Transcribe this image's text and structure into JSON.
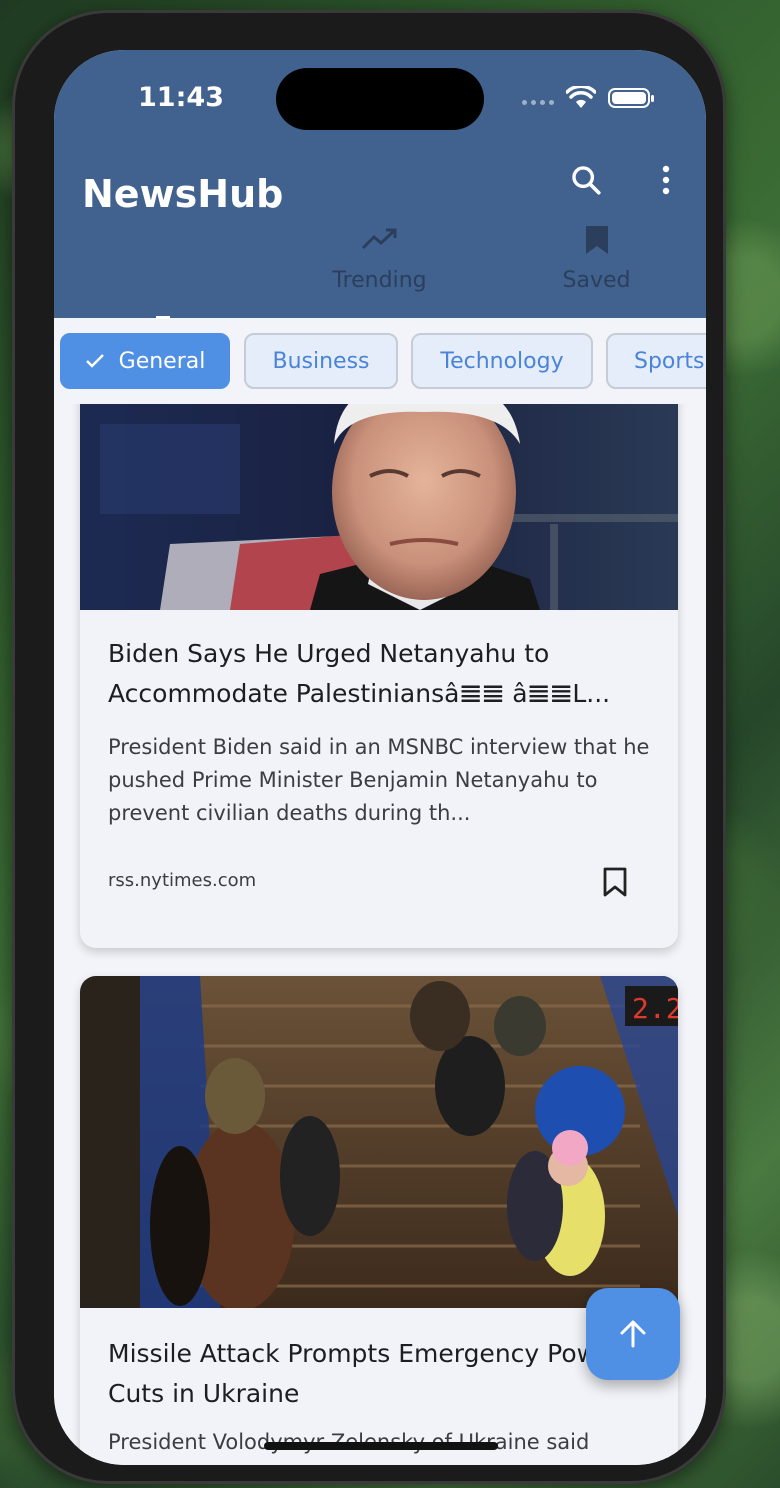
{
  "status": {
    "time": "11:43"
  },
  "app": {
    "title": "NewsHub"
  },
  "icons": {
    "search": "search-icon",
    "more": "more-vert-icon",
    "trending": "trending-up-icon",
    "saved": "bookmark-filled-icon",
    "bookmark": "bookmark-outline-icon",
    "fab": "arrow-up-icon"
  },
  "tabs": [
    {
      "label": ""
    },
    {
      "label": "Trending"
    },
    {
      "label": "Saved"
    }
  ],
  "chips": [
    {
      "label": "General",
      "selected": true
    },
    {
      "label": "Business",
      "selected": false
    },
    {
      "label": "Technology",
      "selected": false
    },
    {
      "label": "Sports",
      "selected": false
    }
  ],
  "articles": [
    {
      "title": "Biden Says He Urged Netanyahu to Accommodate Palestiniansâ𝌆𝌆 â𝌆𝌆L...",
      "description": "President Biden said in an MSNBC interview that he pushed Prime Minister Benjamin Netanyahu to prevent civilian deaths during th...",
      "source": "rss.nytimes.com"
    },
    {
      "title": "Missile Attack Prompts Emergency Power Cuts in Ukraine",
      "description": "President Volodymyr Zelensky of Ukraine said"
    }
  ],
  "colors": {
    "appbar": "#41618f",
    "accent": "#4f90e5",
    "background": "#f3f4f9"
  }
}
